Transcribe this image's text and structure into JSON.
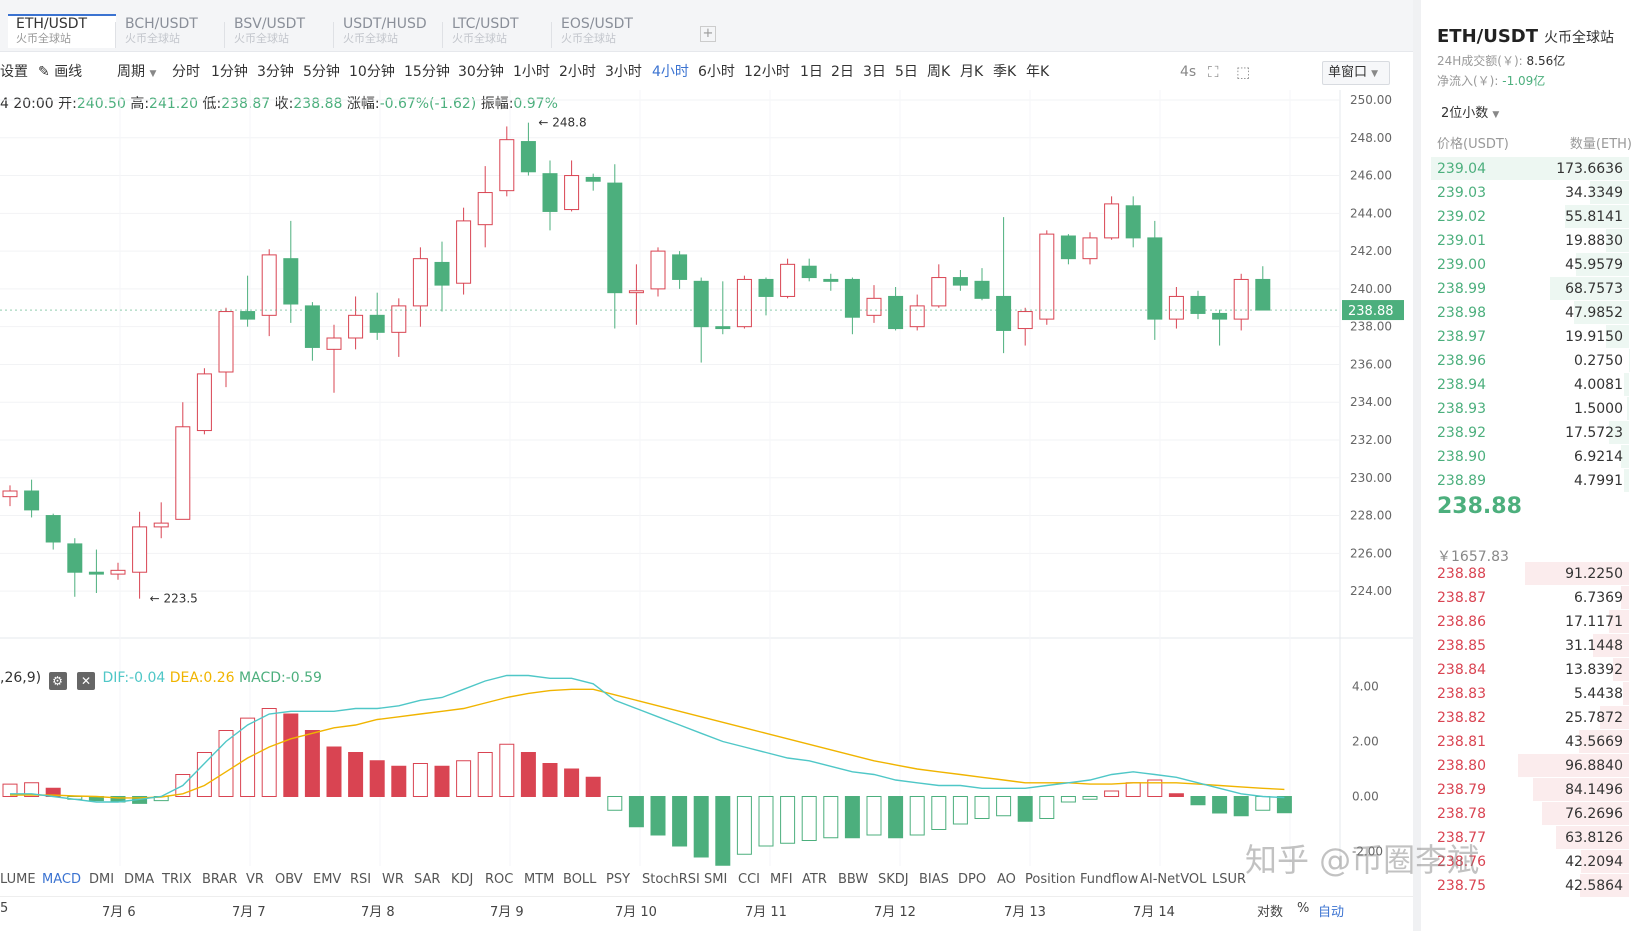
{
  "tabs": [
    {
      "name": "ETH/USDT",
      "exchange": "火币全球站"
    },
    {
      "name": "BCH/USDT",
      "exchange": "火币全球站"
    },
    {
      "name": "BSV/USDT",
      "exchange": "火币全球站"
    },
    {
      "name": "USDT/HUSD",
      "exchange": "火币全球站"
    },
    {
      "name": "LTC/USDT",
      "exchange": "火币全球站"
    },
    {
      "name": "EOS/USDT",
      "exchange": "火币全球站"
    }
  ],
  "add_tab": "+",
  "toolbar": {
    "settings": "设置",
    "draw": "画线",
    "period": "周期",
    "intervals": [
      "分时",
      "1分钟",
      "3分钟",
      "5分钟",
      "10分钟",
      "15分钟",
      "30分钟",
      "1小时",
      "2小时",
      "3小时",
      "4小时",
      "6小时",
      "12小时",
      "1日",
      "2日",
      "3日",
      "5日",
      "周K",
      "月K",
      "季K",
      "年K"
    ],
    "active_interval": "4小时",
    "refresh": "4s",
    "window_mode": "单窗口"
  },
  "info": {
    "time": "4 20:00",
    "open_label": "开:",
    "open": "240.50",
    "high_label": "高:",
    "high": "241.20",
    "low_label": "低:",
    "low": "238.87",
    "close_label": "收:",
    "close": "238.88",
    "change_label": "涨幅:",
    "change": "-0.67%(-1.62)",
    "amp_label": "振幅:",
    "amp": "0.97%"
  },
  "macd_legend": {
    "params": ",26,9)",
    "dif": "DIF:-0.04",
    "dea": "DEA:0.26",
    "macd": "MACD:-0.59"
  },
  "indicators": [
    "LUME",
    "MACD",
    "DMI",
    "DMA",
    "TRIX",
    "BRAR",
    "VR",
    "OBV",
    "EMV",
    "RSI",
    "WR",
    "SAR",
    "KDJ",
    "ROC",
    "MTM",
    "BOLL",
    "PSY",
    "StochRSI",
    "SMI",
    "CCI",
    "MFI",
    "ATR",
    "BBW",
    "SKDJ",
    "BIAS",
    "DPO",
    "AO",
    "Position",
    "Fundflow",
    "AI-NetVOL",
    "LSUR"
  ],
  "active_indicator": "MACD",
  "dates": [
    "5",
    "7月 6",
    "7月 7",
    "7月 8",
    "7月 9",
    "7月 10",
    "7月 11",
    "7月 12",
    "7月 13",
    "7月 14"
  ],
  "bottom_controls": {
    "log": "对数",
    "pct": "%",
    "auto": "自动"
  },
  "colors": {
    "up": "#4caf7d",
    "down": "#d94452",
    "accent": "#3b73d1",
    "dif": "#4fc7c7",
    "dea": "#f0b400"
  },
  "chart_data": {
    "type": "candlestick",
    "ylim": [
      223,
      250
    ],
    "y_ticks": [
      "250.00",
      "248.00",
      "246.00",
      "244.00",
      "242.00",
      "240.00",
      "238.00",
      "236.00",
      "234.00",
      "232.00",
      "230.00",
      "228.00",
      "226.00",
      "224.00"
    ],
    "high_marker": "← 248.8",
    "low_marker": "← 223.5",
    "last_price_tag": "238.88",
    "candles": [
      {
        "o": 229.0,
        "c": 229.3,
        "h": 229.6,
        "l": 228.5
      },
      {
        "o": 229.3,
        "c": 228.3,
        "h": 229.9,
        "l": 227.9
      },
      {
        "o": 228.0,
        "c": 226.6,
        "h": 228.1,
        "l": 226.2
      },
      {
        "o": 226.5,
        "c": 225.0,
        "h": 226.8,
        "l": 223.7
      },
      {
        "o": 225.0,
        "c": 224.9,
        "h": 226.2,
        "l": 223.9
      },
      {
        "o": 224.9,
        "c": 225.1,
        "h": 225.5,
        "l": 224.6
      },
      {
        "o": 225.0,
        "c": 227.4,
        "h": 228.2,
        "l": 223.6
      },
      {
        "o": 227.4,
        "c": 227.6,
        "h": 228.7,
        "l": 226.8
      },
      {
        "o": 227.8,
        "c": 232.7,
        "h": 234.0,
        "l": 227.8
      },
      {
        "o": 232.5,
        "c": 235.5,
        "h": 235.8,
        "l": 232.3
      },
      {
        "o": 235.6,
        "c": 238.8,
        "h": 239.0,
        "l": 234.8
      },
      {
        "o": 238.8,
        "c": 238.4,
        "h": 240.7,
        "l": 238.0
      },
      {
        "o": 238.6,
        "c": 241.8,
        "h": 242.1,
        "l": 237.5
      },
      {
        "o": 241.6,
        "c": 239.2,
        "h": 243.6,
        "l": 238.2
      },
      {
        "o": 239.1,
        "c": 236.9,
        "h": 239.3,
        "l": 236.2
      },
      {
        "o": 236.8,
        "c": 237.4,
        "h": 238.1,
        "l": 234.5
      },
      {
        "o": 237.4,
        "c": 238.6,
        "h": 239.6,
        "l": 236.8
      },
      {
        "o": 238.6,
        "c": 237.7,
        "h": 239.8,
        "l": 237.3
      },
      {
        "o": 237.7,
        "c": 239.1,
        "h": 239.5,
        "l": 236.4
      },
      {
        "o": 239.1,
        "c": 241.6,
        "h": 242.2,
        "l": 238.0
      },
      {
        "o": 241.4,
        "c": 240.2,
        "h": 242.5,
        "l": 238.8
      },
      {
        "o": 240.3,
        "c": 243.6,
        "h": 244.3,
        "l": 239.7
      },
      {
        "o": 243.4,
        "c": 245.1,
        "h": 246.5,
        "l": 242.2
      },
      {
        "o": 245.2,
        "c": 247.9,
        "h": 248.6,
        "l": 244.9
      },
      {
        "o": 247.8,
        "c": 246.2,
        "h": 248.8,
        "l": 246.0
      },
      {
        "o": 246.1,
        "c": 244.1,
        "h": 246.8,
        "l": 243.1
      },
      {
        "o": 244.2,
        "c": 246.0,
        "h": 246.8,
        "l": 244.1
      },
      {
        "o": 245.9,
        "c": 245.7,
        "h": 246.1,
        "l": 245.2
      },
      {
        "o": 245.6,
        "c": 239.8,
        "h": 246.6,
        "l": 237.9
      },
      {
        "o": 239.8,
        "c": 239.9,
        "h": 241.3,
        "l": 238.1
      },
      {
        "o": 240.0,
        "c": 242.0,
        "h": 242.2,
        "l": 239.6
      },
      {
        "o": 241.8,
        "c": 240.5,
        "h": 242.0,
        "l": 240.0
      },
      {
        "o": 240.4,
        "c": 238.0,
        "h": 240.6,
        "l": 236.1
      },
      {
        "o": 238.0,
        "c": 237.9,
        "h": 240.4,
        "l": 237.6
      },
      {
        "o": 238.0,
        "c": 240.5,
        "h": 240.7,
        "l": 237.9
      },
      {
        "o": 240.5,
        "c": 239.6,
        "h": 240.6,
        "l": 238.6
      },
      {
        "o": 239.6,
        "c": 241.3,
        "h": 241.6,
        "l": 239.5
      },
      {
        "o": 241.2,
        "c": 240.6,
        "h": 241.6,
        "l": 240.4
      },
      {
        "o": 240.5,
        "c": 240.4,
        "h": 240.8,
        "l": 239.9
      },
      {
        "o": 240.5,
        "c": 238.5,
        "h": 240.6,
        "l": 237.6
      },
      {
        "o": 238.6,
        "c": 239.5,
        "h": 240.2,
        "l": 238.2
      },
      {
        "o": 239.6,
        "c": 237.9,
        "h": 240.1,
        "l": 237.8
      },
      {
        "o": 238.0,
        "c": 239.1,
        "h": 239.7,
        "l": 237.8
      },
      {
        "o": 239.1,
        "c": 240.6,
        "h": 241.3,
        "l": 239.0
      },
      {
        "o": 240.6,
        "c": 240.2,
        "h": 241.0,
        "l": 239.9
      },
      {
        "o": 240.4,
        "c": 239.5,
        "h": 241.1,
        "l": 239.4
      },
      {
        "o": 239.6,
        "c": 237.8,
        "h": 243.8,
        "l": 236.6
      },
      {
        "o": 237.9,
        "c": 238.8,
        "h": 239.0,
        "l": 237.0
      },
      {
        "o": 238.4,
        "c": 242.9,
        "h": 243.1,
        "l": 238.1
      },
      {
        "o": 242.8,
        "c": 241.6,
        "h": 242.9,
        "l": 241.3
      },
      {
        "o": 241.6,
        "c": 242.7,
        "h": 243.0,
        "l": 241.3
      },
      {
        "o": 242.7,
        "c": 244.5,
        "h": 244.9,
        "l": 242.6
      },
      {
        "o": 244.4,
        "c": 242.7,
        "h": 244.9,
        "l": 242.2
      },
      {
        "o": 242.7,
        "c": 238.4,
        "h": 243.6,
        "l": 237.3
      },
      {
        "o": 238.4,
        "c": 239.6,
        "h": 240.1,
        "l": 237.9
      },
      {
        "o": 239.6,
        "c": 238.7,
        "h": 239.9,
        "l": 238.4
      },
      {
        "o": 238.7,
        "c": 238.4,
        "h": 238.9,
        "l": 237.0
      },
      {
        "o": 238.4,
        "c": 240.5,
        "h": 240.8,
        "l": 237.8
      },
      {
        "o": 240.5,
        "c": 238.88,
        "h": 241.2,
        "l": 238.87
      }
    ],
    "macd_ylim": [
      -2.6,
      4.6
    ],
    "macd_ticks": [
      "4.00",
      "2.00",
      "0.00",
      "-2.00"
    ],
    "macd_hist": [
      0.45,
      0.5,
      0.3,
      -0.1,
      -0.15,
      -0.2,
      -0.25,
      -0.15,
      0.8,
      1.6,
      2.4,
      2.85,
      3.2,
      3.0,
      2.4,
      1.8,
      1.6,
      1.3,
      1.1,
      1.2,
      1.1,
      1.3,
      1.6,
      1.9,
      1.6,
      1.2,
      1.0,
      0.7,
      -0.5,
      -1.1,
      -1.4,
      -1.8,
      -2.2,
      -2.5,
      -2.1,
      -1.8,
      -1.7,
      -1.6,
      -1.5,
      -1.5,
      -1.4,
      -1.5,
      -1.4,
      -1.2,
      -1.0,
      -0.8,
      -0.7,
      -0.9,
      -0.8,
      -0.2,
      -0.1,
      0.2,
      0.5,
      0.6,
      0.1,
      -0.3,
      -0.6,
      -0.7,
      -0.5,
      -0.59
    ],
    "macd_dif": [
      0.1,
      0.1,
      0.0,
      -0.1,
      -0.2,
      -0.2,
      -0.1,
      0.0,
      0.4,
      1.2,
      2.0,
      2.6,
      3.0,
      3.1,
      3.1,
      3.1,
      3.2,
      3.2,
      3.3,
      3.5,
      3.6,
      3.9,
      4.2,
      4.4,
      4.4,
      4.3,
      4.3,
      4.1,
      3.5,
      3.2,
      2.9,
      2.6,
      2.3,
      2.0,
      1.8,
      1.6,
      1.4,
      1.3,
      1.1,
      0.9,
      0.8,
      0.6,
      0.5,
      0.4,
      0.4,
      0.3,
      0.3,
      0.3,
      0.4,
      0.5,
      0.6,
      0.8,
      0.9,
      0.8,
      0.7,
      0.5,
      0.3,
      0.1,
      0.0,
      -0.04
    ],
    "macd_dea": [
      0.05,
      0.05,
      0.05,
      0.02,
      0.0,
      -0.05,
      -0.05,
      -0.02,
      0.1,
      0.4,
      0.9,
      1.4,
      1.8,
      2.1,
      2.3,
      2.5,
      2.6,
      2.8,
      2.9,
      3.0,
      3.1,
      3.2,
      3.4,
      3.6,
      3.75,
      3.85,
      3.9,
      3.9,
      3.7,
      3.5,
      3.3,
      3.1,
      2.9,
      2.7,
      2.5,
      2.3,
      2.1,
      1.9,
      1.7,
      1.5,
      1.3,
      1.15,
      1.0,
      0.9,
      0.8,
      0.7,
      0.6,
      0.5,
      0.5,
      0.5,
      0.45,
      0.45,
      0.5,
      0.5,
      0.5,
      0.45,
      0.4,
      0.35,
      0.3,
      0.26
    ]
  },
  "right_panel": {
    "symbol": "ETH/USDT",
    "exchange": "火币全球站",
    "vol_label": "24H成交额(￥):",
    "vol_value": "8.56亿",
    "inflow_label": "净流入(￥):",
    "inflow_value": "-1.09亿",
    "decimals": "2位小数",
    "price_header": "价格(USDT)",
    "qty_header": "数量(ETH)",
    "bids": [
      {
        "price": "239.04",
        "qty": "173.6636"
      },
      {
        "price": "239.03",
        "qty": "34.3349"
      },
      {
        "price": "239.02",
        "qty": "55.8141"
      },
      {
        "price": "239.01",
        "qty": "19.8830"
      },
      {
        "price": "239.00",
        "qty": "45.9579"
      },
      {
        "price": "238.99",
        "qty": "68.7573"
      },
      {
        "price": "238.98",
        "qty": "47.9852"
      },
      {
        "price": "238.97",
        "qty": "19.9150"
      },
      {
        "price": "238.96",
        "qty": "0.2750"
      },
      {
        "price": "238.94",
        "qty": "4.0081"
      },
      {
        "price": "238.93",
        "qty": "1.5000"
      },
      {
        "price": "238.92",
        "qty": "17.5723"
      },
      {
        "price": "238.90",
        "qty": "6.9214"
      },
      {
        "price": "238.89",
        "qty": "4.7991"
      }
    ],
    "last_price": "238.88",
    "last_cny": "￥1657.83",
    "asks": [
      {
        "price": "238.88",
        "qty": "91.2250"
      },
      {
        "price": "238.87",
        "qty": "6.7369"
      },
      {
        "price": "238.86",
        "qty": "17.1171"
      },
      {
        "price": "238.85",
        "qty": "31.1448"
      },
      {
        "price": "238.84",
        "qty": "13.8392"
      },
      {
        "price": "238.83",
        "qty": "5.4438"
      },
      {
        "price": "238.82",
        "qty": "25.7872"
      },
      {
        "price": "238.81",
        "qty": "43.5669"
      },
      {
        "price": "238.80",
        "qty": "96.8840"
      },
      {
        "price": "238.79",
        "qty": "84.1496"
      },
      {
        "price": "238.78",
        "qty": "76.2696"
      },
      {
        "price": "238.77",
        "qty": "63.8126"
      },
      {
        "price": "238.76",
        "qty": "42.2094"
      },
      {
        "price": "238.75",
        "qty": "42.5864"
      }
    ]
  },
  "watermark": "知乎 @币圈李斌"
}
